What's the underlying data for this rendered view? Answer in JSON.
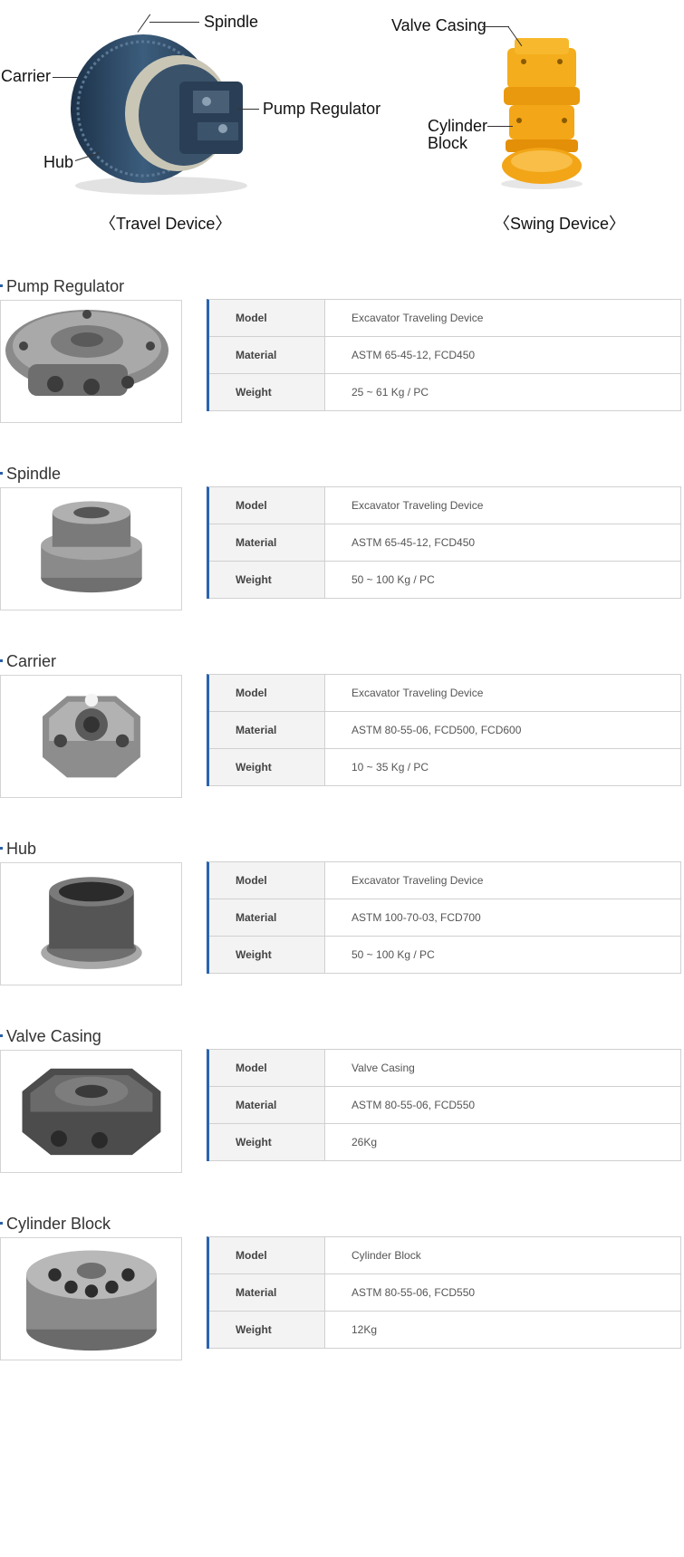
{
  "diagrams": {
    "travel": {
      "labels": {
        "spindle": "Spindle",
        "carrier": "Carrier",
        "pump_regulator": "Pump Regulator",
        "hub": "Hub"
      },
      "caption": "〈Travel Device〉"
    },
    "swing": {
      "labels": {
        "valve_casing": "Valve Casing",
        "cylinder_block_line1": "Cylinder",
        "cylinder_block_line2": "Block"
      },
      "caption": "〈Swing Device〉"
    }
  },
  "colors": {
    "accent": "#2a64b0",
    "table_border": "#d0d0d0",
    "header_bg": "#f3f3f3",
    "travel_device_body": "#2f4a63",
    "swing_device_body": "#f2a516"
  },
  "spec_headers": {
    "model": "Model",
    "material": "Material",
    "weight": "Weight"
  },
  "sections": [
    {
      "title": "Pump Regulator",
      "model": "Excavator Traveling Device",
      "material": "ASTM 65-45-12, FCD450",
      "weight": "25 ~ 61 Kg / PC",
      "image_icon": "pump-regulator-part-photo"
    },
    {
      "title": "Spindle",
      "model": "Excavator Traveling Device",
      "material": "ASTM 65-45-12, FCD450",
      "weight": "50 ~ 100 Kg / PC",
      "image_icon": "spindle-part-photo"
    },
    {
      "title": "Carrier",
      "model": "Excavator Traveling Device",
      "material": "ASTM 80-55-06, FCD500, FCD600",
      "weight": "10 ~ 35 Kg / PC",
      "image_icon": "carrier-part-photo"
    },
    {
      "title": "Hub",
      "model": "Excavator Traveling Device",
      "material": "ASTM 100-70-03, FCD700",
      "weight": "50 ~ 100 Kg / PC",
      "image_icon": "hub-part-photo"
    },
    {
      "title": "Valve Casing",
      "model": "Valve Casing",
      "material": "ASTM  80-55-06, FCD550",
      "weight": "26Kg",
      "image_icon": "valve-casing-part-photo"
    },
    {
      "title": "Cylinder Block",
      "model": "Cylinder Block",
      "material": "ASTM  80-55-06, FCD550",
      "weight": "12Kg",
      "image_icon": "cylinder-block-part-photo"
    }
  ]
}
